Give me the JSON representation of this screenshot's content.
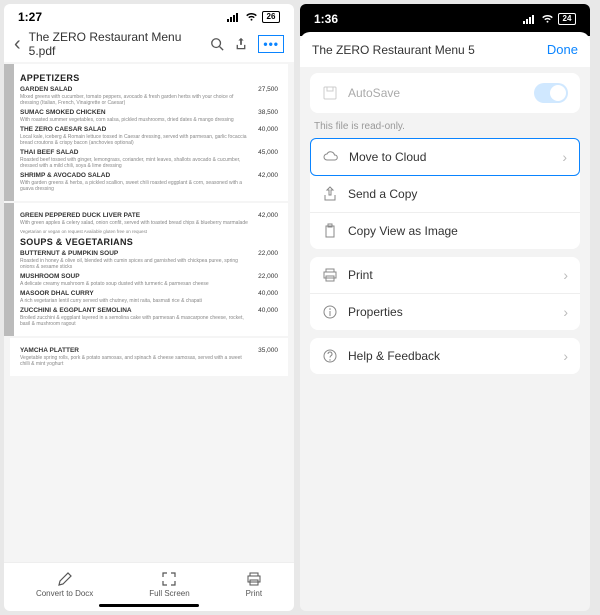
{
  "left": {
    "status": {
      "time": "1:27",
      "battery": "26"
    },
    "title": "The ZERO Restaurant Menu 5.pdf",
    "sections": [
      {
        "heading": "APPETIZERS",
        "items": [
          {
            "name": "GARDEN SALAD",
            "desc": "Mixed greens with cucumber, tomato peppers, avocado & fresh garden herbs with your choice of dressing (Italian, French, Vinaigrette or Caesar)",
            "price": "27,500"
          },
          {
            "name": "SUMAC SMOKED CHICKEN",
            "desc": "With roasted summer vegetables, corn salsa, pickled mushrooms, dried dates & mango dressing",
            "price": "38,500"
          },
          {
            "name": "THE ZERO CAESAR SALAD",
            "desc": "Local kale, iceberg & Romain lettuce tossed in Caesar dressing, served with parmesan, garlic focaccia bread croutons & crispy bacon (anchovies optional)",
            "price": "40,000"
          },
          {
            "name": "THAI BEEF SALAD",
            "desc": "Roasted beef tossed with ginger, lemongrass, coriander, mint leaves, shallots avocado & cucumber, dressed with a mild chili, soya & lime dressing",
            "price": "45,000"
          },
          {
            "name": "SHRIMP & AVOCADO SALAD",
            "desc": "With garden greens & herbs, a pickled scallion, sweet chili roasted eggplant & corn, seasoned with a guava dressing",
            "price": "42,000"
          }
        ]
      },
      {
        "preItems": [
          {
            "name": "GREEN PEPPERED DUCK LIVER PATE",
            "desc": "With green apples & celery salad, onion confit, served with toasted bread chips & blueberry marmalade",
            "price": "42,000"
          }
        ],
        "note": "Vegetarian or vegan on request    Available gluten free on request",
        "heading": "SOUPS & VEGETARIANS",
        "items": [
          {
            "name": "BUTTERNUT & PUMPKIN SOUP",
            "desc": "Roasted in honey & olive oil, blended with cumin spices and garnished with chickpea puree, spring onions & sesame sticks",
            "price": "22,000"
          },
          {
            "name": "MUSHROOM SOUP",
            "desc": "A delicate creamy mushroom & potato soup dusted with turmeric & parmesan cheese",
            "price": "22,000"
          },
          {
            "name": "MASOOR DHAL CURRY",
            "desc": "A rich vegetarian lentil curry served with chutney, mint raita, basmati rice & chapati",
            "price": "40,000"
          },
          {
            "name": "ZUCCHINI & EGGPLANT SEMOLINA",
            "desc": "Broiled zucchini & eggplant layered in a semolina cake with parmesan & mascarpone cheese, rocket, basil & mushroom ragout",
            "price": "40,000"
          }
        ]
      },
      {
        "items": [
          {
            "name": "YAMCHA PLATTER",
            "desc": "Vegetable spring rolls, pork & potato samosas, and spinach & cheese samosas, served with a sweet chilli & mint yoghurt",
            "price": "35,000"
          }
        ]
      }
    ],
    "bottom": {
      "convert": "Convert to Docx",
      "fullscreen": "Full Screen",
      "print": "Print"
    }
  },
  "right": {
    "status": {
      "time": "1:36",
      "battery": "24"
    },
    "title": "The ZERO Restaurant Menu 5",
    "done": "Done",
    "autosave": "AutoSave",
    "readonly": "This file is read-only.",
    "rows": {
      "move": "Move to Cloud",
      "send": "Send a Copy",
      "copy": "Copy View as Image",
      "print": "Print",
      "props": "Properties",
      "help": "Help & Feedback"
    }
  }
}
